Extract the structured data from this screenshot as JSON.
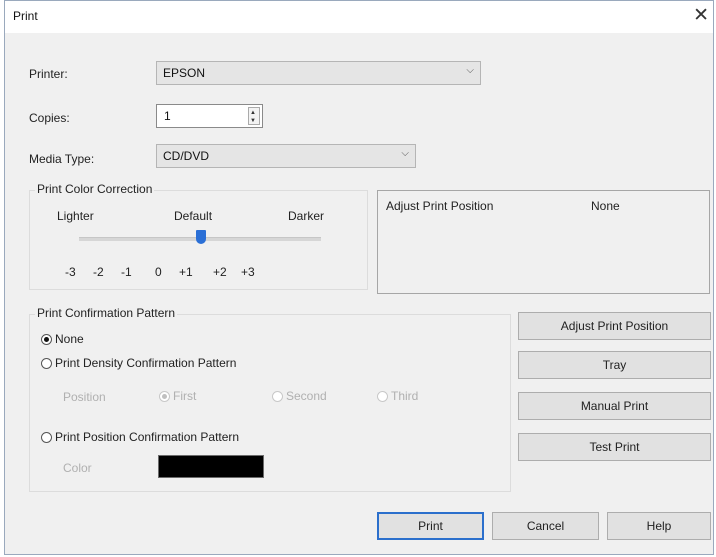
{
  "window": {
    "title": "Print",
    "close_glyph": "✕"
  },
  "printer": {
    "label": "Printer:",
    "value": "EPSON"
  },
  "copies": {
    "label": "Copies:",
    "value": "1"
  },
  "media_type": {
    "label": "Media Type:",
    "value": "CD/DVD"
  },
  "color_correction": {
    "title": "Print Color Correction",
    "lighter": "Lighter",
    "default": "Default",
    "darker": "Darker",
    "ticks": [
      "-3",
      "-2",
      "-1",
      "0",
      "+1",
      "+2",
      "+3"
    ],
    "selected_value": "0"
  },
  "adjust_panel": {
    "label": "Adjust Print Position",
    "value": "None"
  },
  "confirmation": {
    "title": "Print Confirmation Pattern",
    "none_label": "None",
    "density_label": "Print Density Confirmation Pattern",
    "position_label": "Position",
    "first_label": "First",
    "second_label": "Second",
    "third_label": "Third",
    "pos_pattern_label": "Print Position Confirmation Pattern",
    "color_label": "Color",
    "color_value": "#000000"
  },
  "side_buttons": {
    "adjust": "Adjust Print Position",
    "tray": "Tray",
    "manual": "Manual Print",
    "test": "Test Print"
  },
  "footer": {
    "print": "Print",
    "cancel": "Cancel",
    "help": "Help"
  }
}
